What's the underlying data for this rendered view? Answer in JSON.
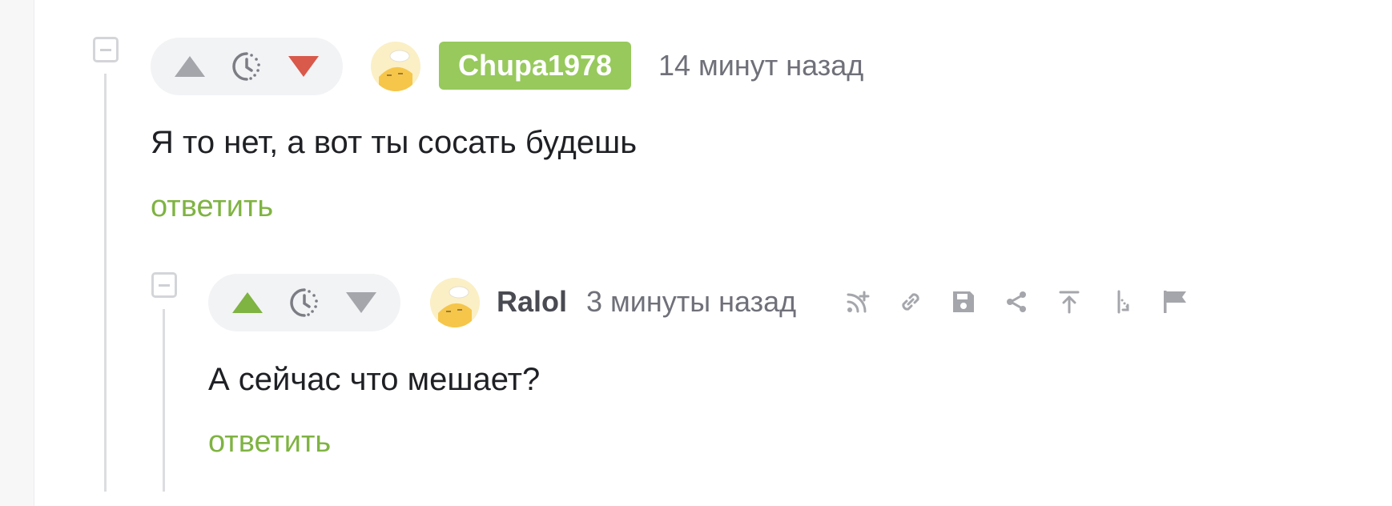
{
  "comments": [
    {
      "username": "Chupa1978",
      "timestamp": "14 минут назад",
      "text": "Я то нет, а вот ты сосать будешь",
      "reply_label": "ответить",
      "vote_state": "downvoted"
    },
    {
      "username": "Ralol",
      "timestamp": "3 минуты назад",
      "text": "А сейчас что мешает?",
      "reply_label": "ответить",
      "vote_state": "upvoted"
    }
  ],
  "toolbar_icons": [
    "subscribe-icon",
    "link-icon",
    "save-icon",
    "share-icon",
    "scroll-to-parent-icon",
    "branch-icon",
    "report-flag-icon"
  ],
  "colors": {
    "upvote_active": "#7fb342",
    "downvote_active": "#d9594a",
    "vote_inactive": "#a5a6ab",
    "author_badge": "#97c95c",
    "reply_link": "#7fb342"
  }
}
